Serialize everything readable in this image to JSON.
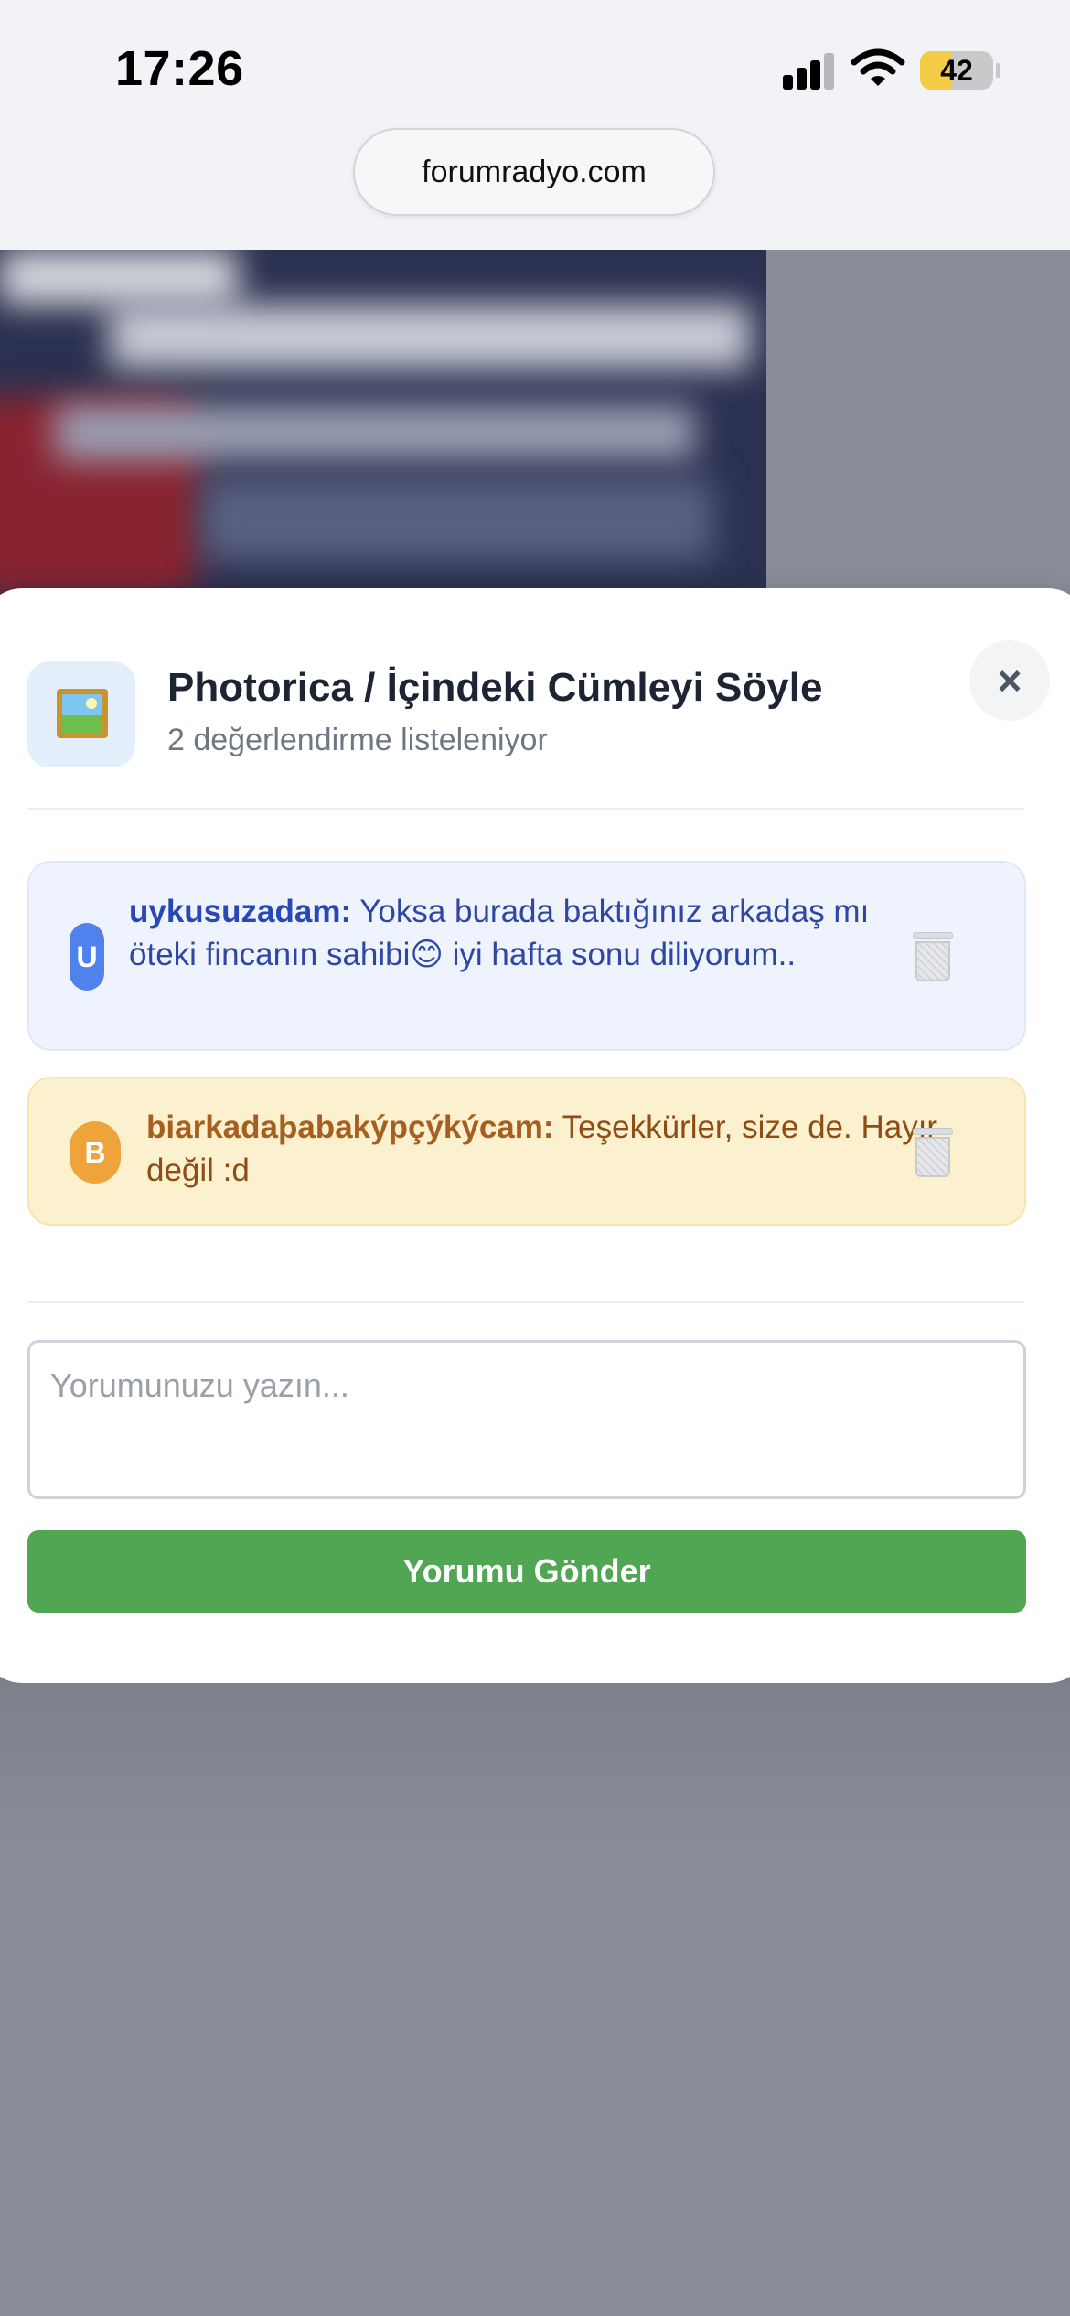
{
  "status_bar": {
    "time": "17:26",
    "battery_level": "42",
    "battery_fraction": 0.42,
    "icons": [
      "cellular-signal-icon",
      "wifi-icon",
      "battery-icon"
    ]
  },
  "browser": {
    "url": "forumradyo.com"
  },
  "sheet": {
    "header_icon": "framed-picture-icon",
    "title": "Photorica / İçindeki Cümleyi Söyle",
    "subtitle": "2 değerlendirme listeleniyor",
    "close_label": "×",
    "close_icon": "close-icon"
  },
  "comments": [
    {
      "avatar_letter": "U",
      "username": "uykusuzadam:",
      "text": " Yoksa burada baktığınız arkadaş mı öteki fincanın sahibi😊 iyi hafta sonu diliyorum..",
      "delete_icon": "trash-icon",
      "accent_color": "#4f82ec"
    },
    {
      "avatar_letter": "B",
      "username": "biarkadaþabakýpçýkýcam:",
      "text": " Teşekkürler, size de. Hayır değil :d",
      "delete_icon": "trash-icon",
      "accent_color": "#eea43a"
    }
  ],
  "compose": {
    "placeholder": "Yorumunuzu yazın...",
    "value": "",
    "submit_label": "Yorumu Gönder",
    "submit_color": "#50a653"
  }
}
